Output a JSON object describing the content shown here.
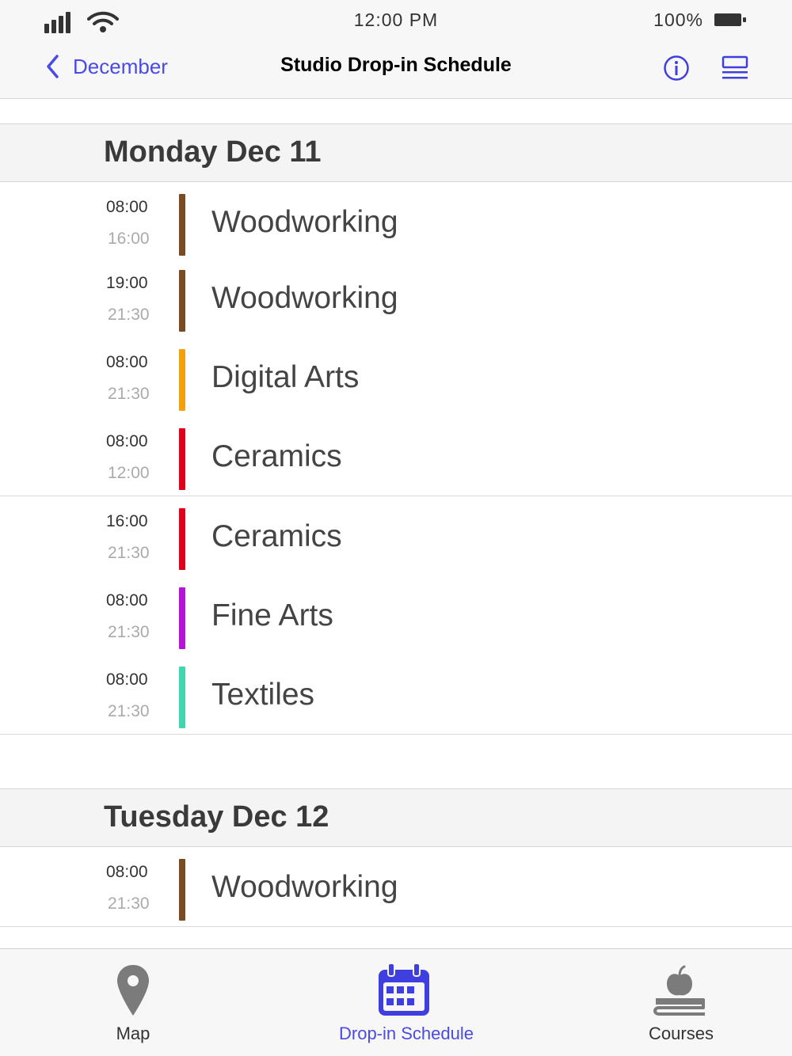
{
  "status": {
    "time": "12:00 PM",
    "battery": "100%"
  },
  "nav": {
    "back_label": "December",
    "title": "Studio Drop-in Schedule"
  },
  "colors": {
    "accent": "#3f3fe0",
    "Woodworking": "#7a4b23",
    "Digital Arts": "#f4a00c",
    "Ceramics": "#e0001b",
    "Fine Arts": "#b514d8",
    "Textiles": "#3fd6b0"
  },
  "days": [
    {
      "title": "Monday Dec 11",
      "sessions": [
        {
          "start": "08:00",
          "end": "16:00",
          "course": "Woodworking",
          "color": "#7a4b23"
        },
        {
          "start": "19:00",
          "end": "21:30",
          "course": "Woodworking",
          "color": "#7a4b23"
        },
        {
          "start": "08:00",
          "end": "21:30",
          "course": "Digital Arts",
          "color": "#f4a00c"
        },
        {
          "start": "08:00",
          "end": "12:00",
          "course": "Ceramics",
          "color": "#e0001b"
        },
        {
          "start": "16:00",
          "end": "21:30",
          "course": "Ceramics",
          "color": "#e0001b"
        },
        {
          "start": "08:00",
          "end": "21:30",
          "course": "Fine Arts",
          "color": "#b514d8"
        },
        {
          "start": "08:00",
          "end": "21:30",
          "course": "Textiles",
          "color": "#3fd6b0"
        }
      ]
    },
    {
      "title": "Tuesday Dec 12",
      "sessions": [
        {
          "start": "08:00",
          "end": "21:30",
          "course": "Woodworking",
          "color": "#7a4b23"
        }
      ]
    }
  ],
  "tabs": [
    {
      "label": "Map",
      "icon": "map-pin-icon",
      "active": false
    },
    {
      "label": "Drop-in Schedule",
      "icon": "calendar-icon",
      "active": true
    },
    {
      "label": "Courses",
      "icon": "apple-books-icon",
      "active": false
    }
  ]
}
